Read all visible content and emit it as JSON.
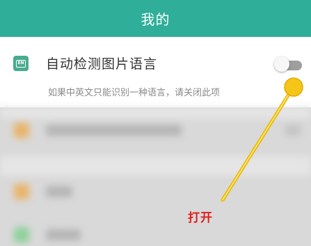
{
  "header": {
    "title": "我的"
  },
  "setting": {
    "icon": "language-badge-icon",
    "icon_text": "EN",
    "title": "自动检测图片语言",
    "description": "如果中英文只能识别一种语言，请关闭此项",
    "toggle_state": "off"
  },
  "annotation": {
    "text": "打开",
    "color": "#e0201b",
    "marker_color": "#f5c518"
  },
  "colors": {
    "accent": "#2fae9a",
    "icon_green": "#49ab8f"
  }
}
